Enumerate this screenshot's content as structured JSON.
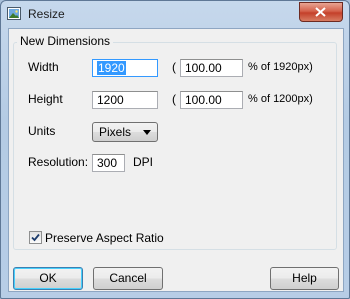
{
  "window": {
    "title": "Resize"
  },
  "group": {
    "legend": "New Dimensions"
  },
  "width": {
    "label": "Width",
    "value": "1920",
    "paren": "(",
    "percent": "100.00",
    "suffix": "% of 1920px)"
  },
  "height": {
    "label": "Height",
    "value": "1200",
    "paren": "(",
    "percent": "100.00",
    "suffix": "% of 1200px)"
  },
  "units": {
    "label": "Units",
    "selected": "Pixels"
  },
  "resolution": {
    "label": "Resolution:",
    "value": "300",
    "unit": "DPI"
  },
  "aspect": {
    "label": "Preserve Aspect Ratio",
    "checked": true
  },
  "buttons": {
    "ok": "OK",
    "cancel": "Cancel",
    "help": "Help"
  },
  "colors": {
    "selection": "#3399ff",
    "close_button": "#c4402a",
    "frame": "#b4cbe4"
  },
  "icons": {
    "app": "image-icon",
    "close": "close-icon",
    "dropdown": "dropdown-arrow-icon",
    "check": "checkmark-icon"
  }
}
